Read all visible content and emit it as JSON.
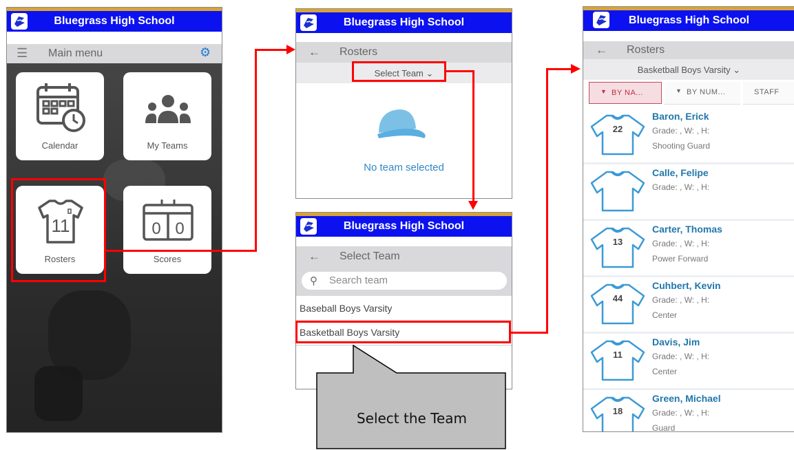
{
  "school_name": "Bluegrass High School",
  "screen1": {
    "menu_title": "Main menu",
    "tiles": [
      {
        "label": "Calendar",
        "icon": "calendar-icon"
      },
      {
        "label": "My Teams",
        "icon": "team-icon"
      },
      {
        "label": "Rosters",
        "icon": "jersey-icon",
        "jersey_number": "11"
      },
      {
        "label": "Scores",
        "icon": "scoreboard-icon",
        "score_left": "0",
        "score_right": "0"
      }
    ]
  },
  "screen2": {
    "title": "Rosters",
    "select_label": "Select Team",
    "empty_text": "No team selected"
  },
  "screen3": {
    "title": "Select Team",
    "search_placeholder": "Search team",
    "teams": [
      "Baseball Boys Varsity",
      "Basketball Boys Varsity"
    ]
  },
  "callout": {
    "text": "Select the Team"
  },
  "screen4": {
    "title": "Rosters",
    "team": "Basketball Boys Varsity",
    "tabs": [
      "BY NA...",
      "BY NUM...",
      "STAFF"
    ],
    "players": [
      {
        "name": "Baron, Erick",
        "number": "22",
        "meta": "Grade: , W: , H:",
        "position": "Shooting Guard"
      },
      {
        "name": "Calle, Felipe",
        "number": "",
        "meta": "Grade: , W: , H:",
        "position": ""
      },
      {
        "name": "Carter, Thomas",
        "number": "13",
        "meta": "Grade: , W: , H:",
        "position": "Power Forward"
      },
      {
        "name": "Cuhbert, Kevin",
        "number": "44",
        "meta": "Grade: , W: , H:",
        "position": "Center"
      },
      {
        "name": "Davis, Jim",
        "number": "11",
        "meta": "Grade: , W: , H:",
        "position": "Center"
      },
      {
        "name": "Green, Michael",
        "number": "18",
        "meta": "Grade: , W: , H:",
        "position": "Guard"
      }
    ]
  },
  "colors": {
    "app_bar": "#0c12ef",
    "accent_gold": "#d8a437",
    "highlight_red": "#ff0000",
    "player_name": "#2177ab",
    "cap_blue": "#7dc0e6"
  }
}
